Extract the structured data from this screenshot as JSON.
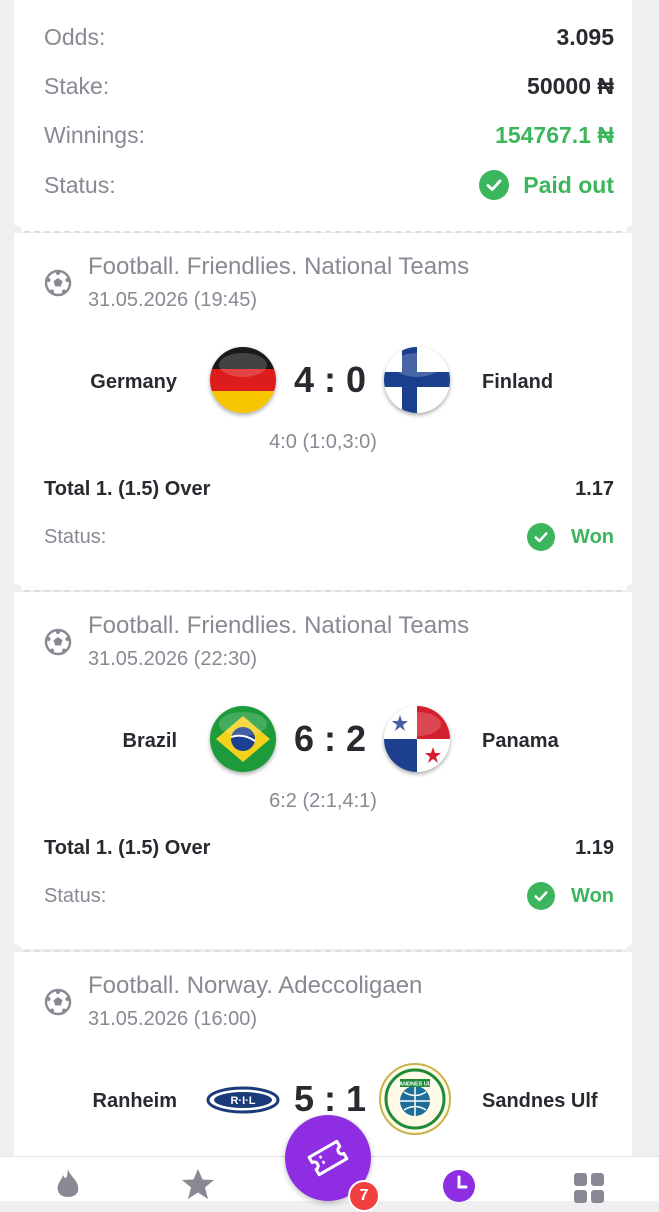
{
  "summary": {
    "odds_label": "Odds:",
    "odds_value": "3.095",
    "stake_label": "Stake:",
    "stake_value": "50000 ₦",
    "winnings_label": "Winnings:",
    "winnings_value": "154767.1 ₦",
    "status_label": "Status:",
    "status_value": "Paid out"
  },
  "events": [
    {
      "league": "Football. Friendlies. National Teams",
      "datetime": "31.05.2026 (19:45)",
      "home": "Germany",
      "away": "Finland",
      "score": "4 : 0",
      "score_detail": "4:0 (1:0,3:0)",
      "bet": "Total 1. (1.5) Over",
      "odds": "1.17",
      "status_label": "Status:",
      "status": "Won"
    },
    {
      "league": "Football. Friendlies. National Teams",
      "datetime": "31.05.2026 (22:30)",
      "home": "Brazil",
      "away": "Panama",
      "score": "6 : 2",
      "score_detail": "6:2 (2:1,4:1)",
      "bet": "Total 1. (1.5) Over",
      "odds": "1.19",
      "status_label": "Status:",
      "status": "Won"
    },
    {
      "league": "Football. Norway. Adeccoligaen",
      "datetime": "31.05.2026 (16:00)",
      "home": "Ranheim",
      "away": "Sandnes Ulf",
      "score": "5 : 1",
      "home_logo_text": "R·I·L",
      "away_logo_text": "SANDNES ULF"
    }
  ],
  "nav": {
    "items": [
      "fire-icon",
      "star-icon",
      "ticket-icon",
      "history-icon",
      "menu-grid-icon"
    ],
    "badge": "7"
  },
  "colors": {
    "accent": "#8f2de3",
    "success": "#3cb65c",
    "badge": "#f04040",
    "muted": "#8a8893"
  }
}
